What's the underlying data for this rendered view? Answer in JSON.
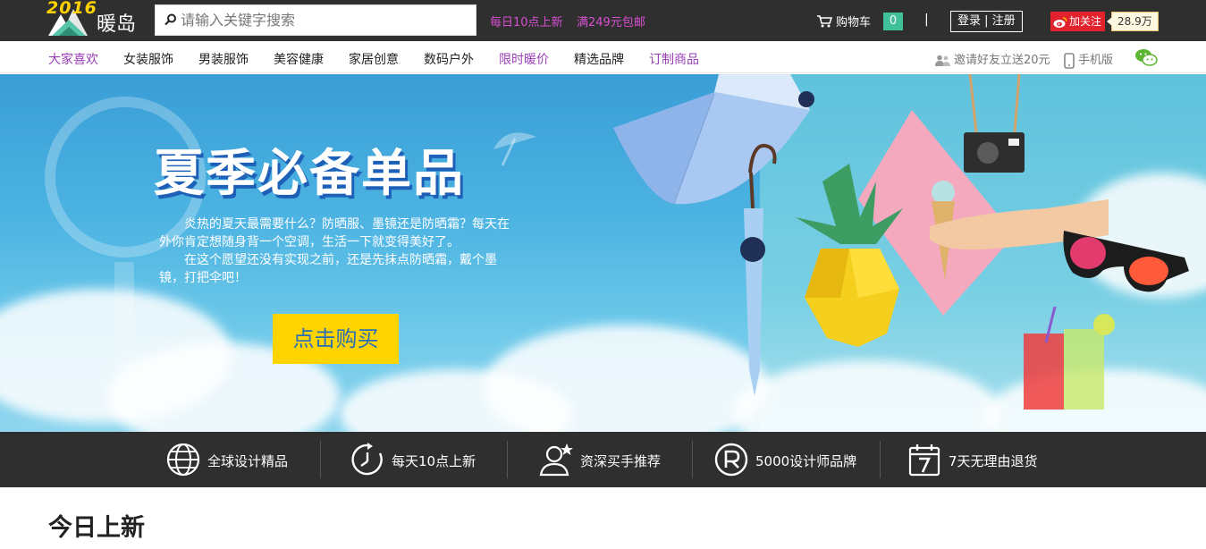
{
  "header": {
    "logo_year": "2016",
    "logo_text": "暖岛",
    "search": {
      "placeholder": "请输入关键字搜索"
    },
    "promo_1": "每日10点上新",
    "promo_2": "满249元包邮",
    "cart_label": "购物车",
    "cart_count": "0",
    "separator": "|",
    "login_label": "登录 | 注册",
    "weibo_follow": "加关注",
    "followers": "28.9万",
    "colors": {
      "bar_bg": "#2f2f2f",
      "promo": "#d94fd1",
      "cart_badge": "#3fbf9a",
      "weibo": "#e2222d"
    }
  },
  "nav": {
    "categories": [
      {
        "label": "大家喜欢",
        "highlight": true
      },
      {
        "label": "女装服饰",
        "highlight": false
      },
      {
        "label": "男装服饰",
        "highlight": false
      },
      {
        "label": "美容健康",
        "highlight": false
      },
      {
        "label": "家居创意",
        "highlight": false
      },
      {
        "label": "数码户外",
        "highlight": false
      },
      {
        "label": "限时暖价",
        "highlight": true
      },
      {
        "label": "精选品牌",
        "highlight": false
      },
      {
        "label": "订制商品",
        "highlight": true
      }
    ],
    "invite_label": "邀请好友立送20元",
    "mobile_label": "手机版",
    "icons": [
      "users-icon",
      "phone-icon",
      "wechat-icon"
    ]
  },
  "banner": {
    "title": "夏季必备单品",
    "desc_1": "炎热的夏天最需要什么？防晒服、墨镜还是防晒霜？每天在外你肯定想随身背一个空调，生活一下就变得美好了。",
    "desc_2": "在这个愿望还没有实现之前，还是先抹点防晒霜，戴个墨镜，打把伞吧！",
    "button_label": "点击购买"
  },
  "features": [
    {
      "icon": "globe-icon",
      "label": "全球设计精品"
    },
    {
      "icon": "clock-icon",
      "label": "每天10点上新"
    },
    {
      "icon": "user-star-icon",
      "label": "资深买手推荐"
    },
    {
      "icon": "registered-icon",
      "label": "5000设计师品牌"
    },
    {
      "icon": "calendar-icon",
      "label": "7天无理由退货"
    }
  ],
  "section": {
    "title": "今日上新"
  }
}
